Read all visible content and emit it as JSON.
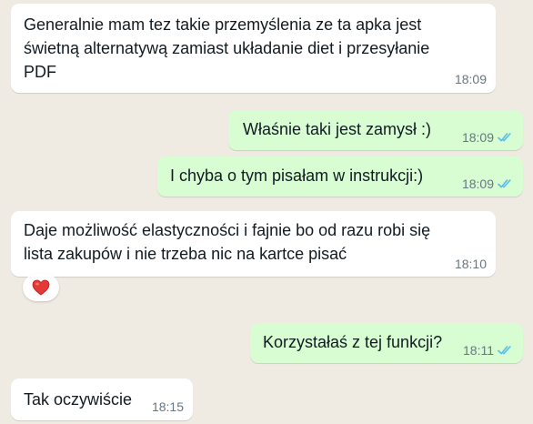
{
  "colors": {
    "background": "#efeae2",
    "incoming_bubble": "#ffffff",
    "outgoing_bubble": "#d9fdd3",
    "read_ticks": "#53bdeb",
    "timestamp": "#667781"
  },
  "messages": [
    {
      "direction": "incoming",
      "lines": [
        "Generalnie mam tez takie przemyślenia ze ta apka jest",
        "świetną alternatywą zamiast układanie diet i przesyłanie",
        "PDF"
      ],
      "time": "18:09"
    },
    {
      "direction": "outgoing",
      "lines": [
        "Właśnie taki jest zamysł :)"
      ],
      "time": "18:09",
      "status_icon": "double-check-read-icon"
    },
    {
      "direction": "outgoing",
      "lines": [
        "I chyba o tym pisałam w instrukcji:)"
      ],
      "time": "18:09",
      "status_icon": "double-check-read-icon"
    },
    {
      "direction": "incoming",
      "lines": [
        "Daje możliwość elastyczności i fajnie bo od razu robi się",
        "lista zakupów i nie trzeba nic na kartce pisać"
      ],
      "time": "18:10",
      "reaction": "❤️"
    },
    {
      "direction": "outgoing",
      "lines": [
        "Korzystałaś z tej funkcji?"
      ],
      "time": "18:11",
      "status_icon": "double-check-read-icon"
    },
    {
      "direction": "incoming",
      "lines": [
        "Tak oczywiście"
      ],
      "time": "18:15"
    }
  ]
}
